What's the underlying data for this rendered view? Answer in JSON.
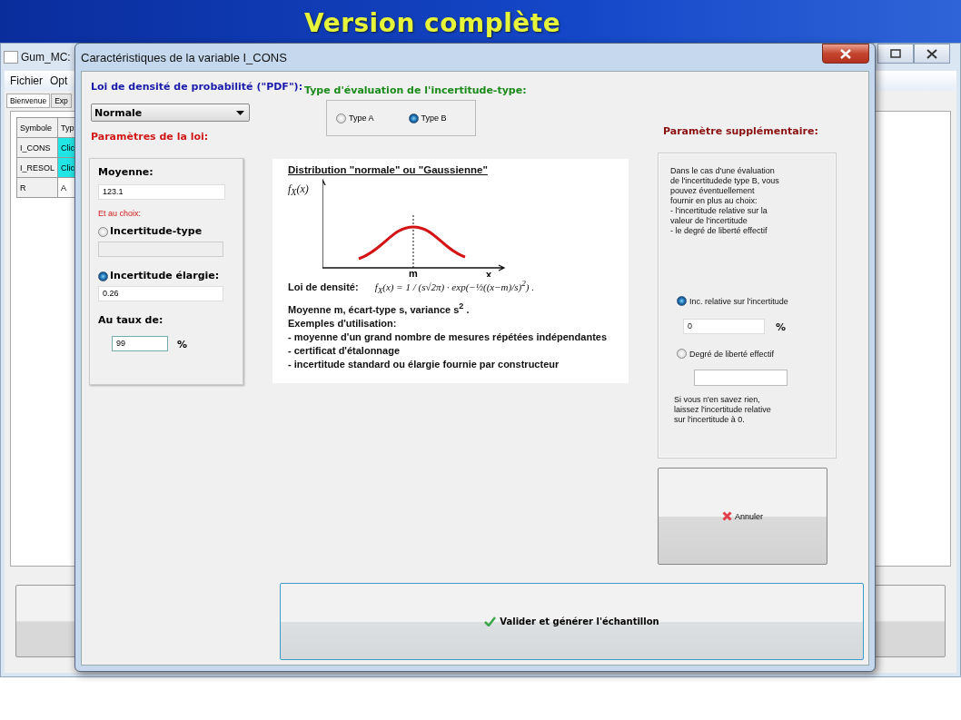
{
  "slide_title": "Version complète",
  "background_window": {
    "title": "Gum_MC:",
    "menu": [
      "Fichier",
      "Opt"
    ],
    "tabs": [
      {
        "label": "Bienvenue",
        "selected": true
      },
      {
        "label": "Exp",
        "selected": false
      }
    ],
    "table": {
      "columns": [
        "Symbole",
        "Typ"
      ],
      "rows": [
        {
          "cells": [
            "I_CONS",
            "Clic"
          ],
          "highlighted": true
        },
        {
          "cells": [
            "I_RESOL",
            "Clic"
          ],
          "highlighted": true
        },
        {
          "cells": [
            "R",
            "A"
          ],
          "highlighted": false
        }
      ]
    }
  },
  "dialog": {
    "title": "Caractéristiques de la variable I_CONS",
    "pdf_label": "Loi de densité de probabilité (\"PDF\"):",
    "pdf_select": "Normale",
    "params_label": "Paramètres de la loi:",
    "params": {
      "mean_label": "Moyenne:",
      "mean_value": "123.1",
      "choice_label": "Et au choix:",
      "options": [
        {
          "label": "Incertitude-type",
          "selected": false,
          "disabled": true
        },
        {
          "label": "Incertitude élargie:",
          "selected": true,
          "disabled": false,
          "value": "0.26"
        }
      ],
      "rate_label": "Au taux de:",
      "rate_value": "99",
      "rate_unit": "%"
    },
    "eval_type": {
      "label": "Type d'évaluation de l'incertitude-type:",
      "options": [
        {
          "label": "Type A",
          "selected": false
        },
        {
          "label": "Type B",
          "selected": true
        }
      ]
    },
    "info": {
      "title": "Distribution \"normale\" ou \"Gaussienne\"",
      "y_label": "f$_{X}$(x)",
      "m_label": "m",
      "x_label": "x",
      "density_label": "Loi de densité:",
      "formula": "f$_{X}$(x) = 1 / (s√2π) · exp(−½((x−m)/s)$^{2}$)  .",
      "moments": "Moyenne m, écart-type s, variance  s$^{2}$ .",
      "examples_label": "Exemples d'utilisation:",
      "examples": [
        "- moyenne d'un grand nombre de mesures répétées indépendantes",
        "- certificat d'étalonnage",
        "- incertitude standard ou élargie fournie par constructeur"
      ]
    },
    "extra": {
      "label": "Paramètre supplémentaire:",
      "description": "Dans le cas d'une évaluation\nde l'incertitudede type B, vous\npouvez éventuellement\nfournir en plus au choix:\n- l'incertitude relative sur la\nvaleur de l'incertitude\n- le degré de liberté effectif",
      "options": [
        {
          "label": "Inc. relative sur l'incertitude",
          "selected": true,
          "value": "0",
          "unit": "%"
        },
        {
          "label": "Degré de liberté effectif",
          "selected": false
        }
      ],
      "note": "Si vous n'en savez rien,\nlaissez l'incertitude relative\nsur l'incertitude à 0."
    },
    "cancel_button": "Annuler",
    "validate_button": "Valider et générer l'échantillon"
  }
}
